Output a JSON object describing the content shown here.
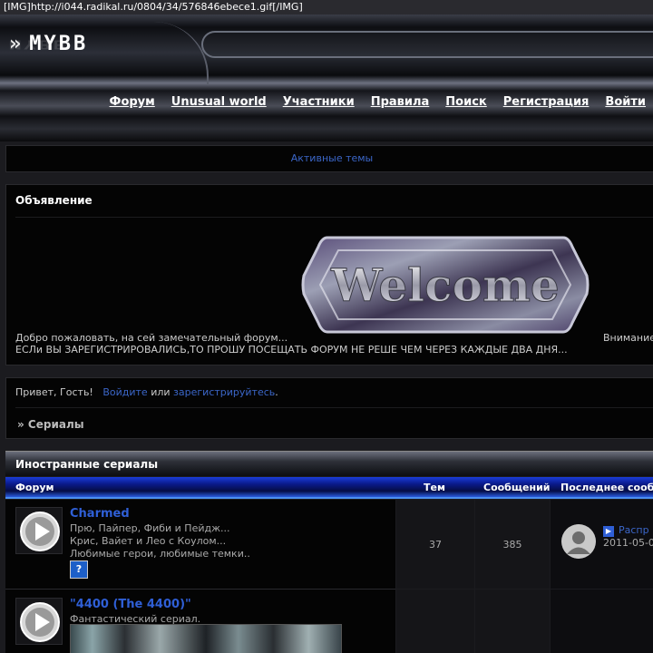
{
  "topbar": {
    "text": "[IMG]http://i044.radikal.ru/0804/34/576846ebece1.gif[/IMG]"
  },
  "header": {
    "logo_text": "MYBB",
    "logo_chevron": "»"
  },
  "nav": {
    "items": [
      {
        "label": "Форум"
      },
      {
        "label": "Unusual world"
      },
      {
        "label": "Участники"
      },
      {
        "label": "Правила"
      },
      {
        "label": "Поиск"
      },
      {
        "label": "Регистрация"
      },
      {
        "label": "Войти"
      }
    ]
  },
  "active_topics": {
    "label": "Активные темы"
  },
  "announcement": {
    "title": "Объявление",
    "image_text": "Welcome",
    "text_line1": "Добро пожаловать, на сей замечательный форум...",
    "text_right": "Внимание",
    "text_line2": "ЕСЛи ВЫ ЗАРЕГИСТРИРОВАЛИСЬ,ТО ПРОШУ ПОСЕЩАТЬ ФОРУМ НЕ РЕШЕ ЧЕМ ЧЕРЕЗ КАЖДЫЕ ДВА ДНЯ..."
  },
  "greeting": {
    "prefix": "Привет, Гость!",
    "login_link": "Войдите",
    "or": "или",
    "register_link": "зарегистрируйтесь",
    "suffix": ".",
    "breadcrumb": "» Сериалы"
  },
  "category": {
    "title": "Иностранные сериалы",
    "columns": {
      "forum": "Форум",
      "topics": "Тем",
      "posts": "Сообщений",
      "last": "Последнее сооб"
    }
  },
  "forums": [
    {
      "title": "Charmed",
      "desc": [
        "Прю, Пайпер, Фиби и Пейдж...",
        "Крис, Вайет и Лео с Коулом...",
        "Любимые герои, любимые темки.."
      ],
      "help_icon": "?",
      "topics": "37",
      "posts": "385",
      "last_link": "Распр",
      "last_date": "2011-05-0"
    },
    {
      "title": "\"4400 (The 4400)\"",
      "desc": [
        "Фантастический сериал."
      ]
    }
  ],
  "colors": {
    "link": "#3b66c8",
    "forum_title": "#2f5fd6",
    "column_bar": "#0a1a8a"
  },
  "icons": {
    "forum_status": "play-circle-icon",
    "help": "question-mark-icon",
    "avatar": "user-avatar-icon",
    "last_post": "arrow-right-icon"
  }
}
